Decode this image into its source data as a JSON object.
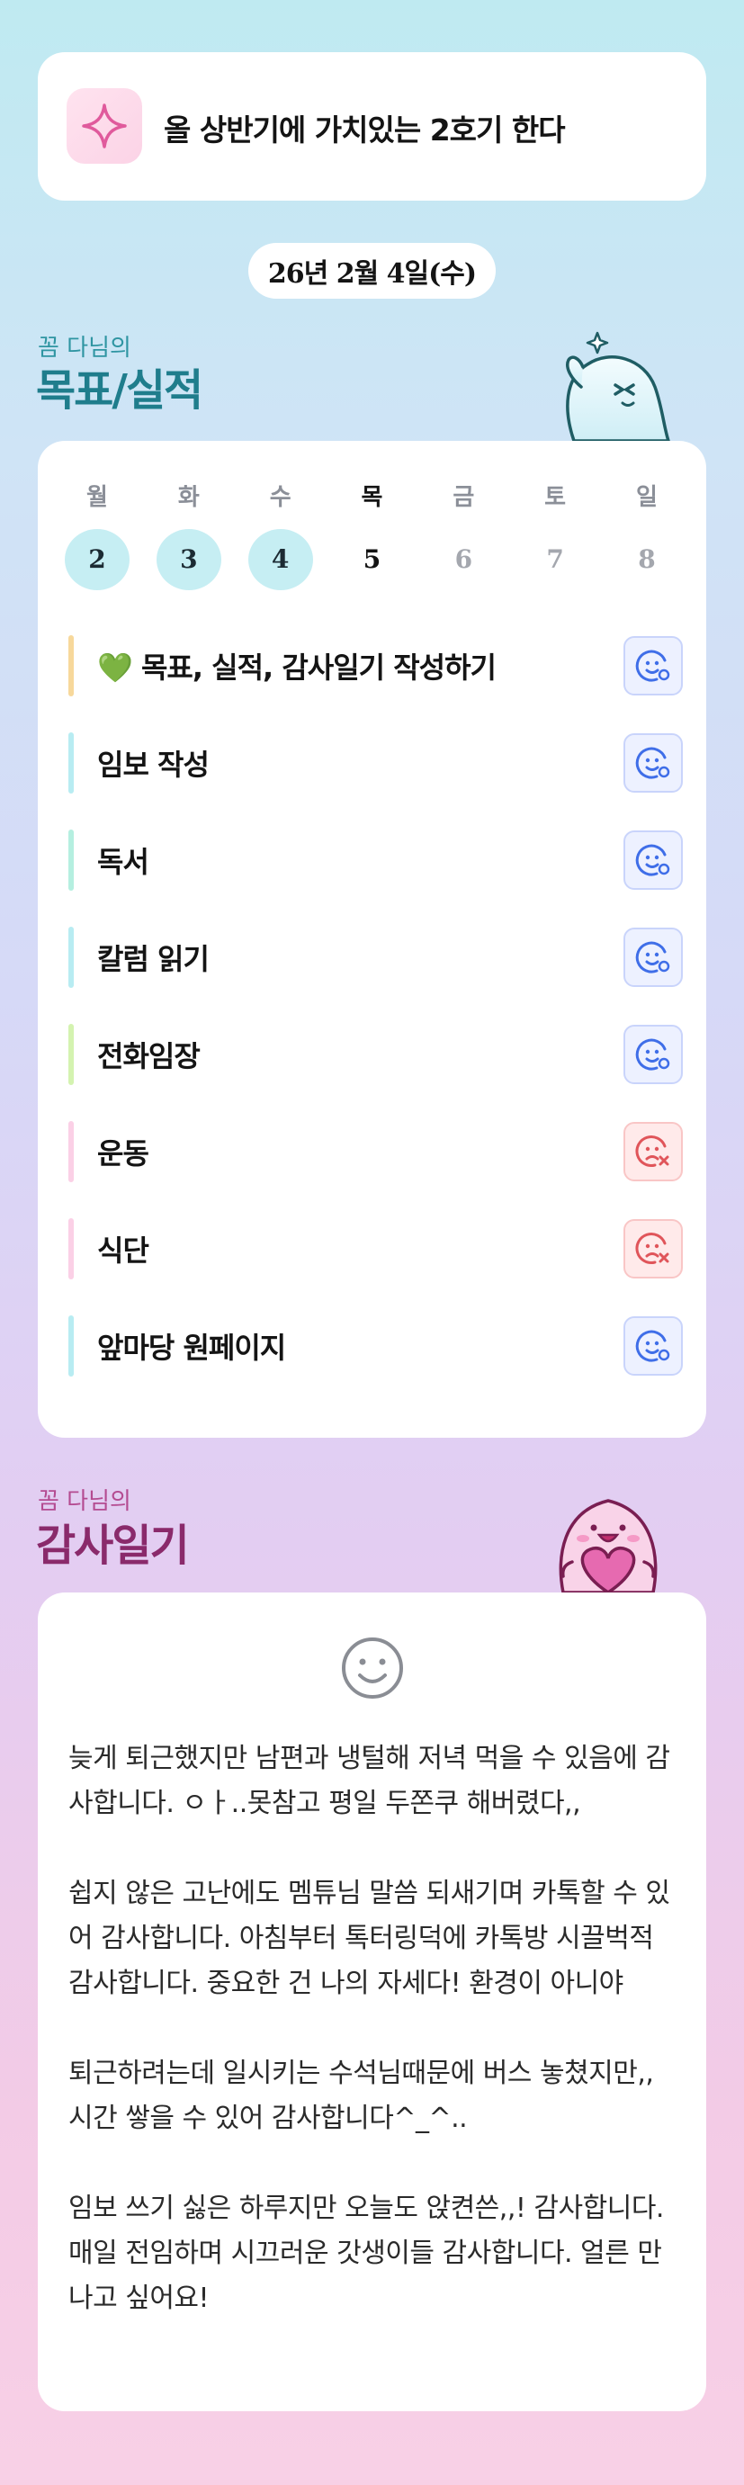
{
  "motto": {
    "text": "올 상반기에 가치있는 2호기 한다",
    "icon": "sparkle-icon"
  },
  "date_label": "26년 2월 4일(수)",
  "goals_section": {
    "small_title": "꼼 다님의",
    "big_title": "목표/실적"
  },
  "calendar": {
    "weekdays": [
      "월",
      "화",
      "수",
      "목",
      "금",
      "토",
      "일"
    ],
    "days": [
      "2",
      "3",
      "4",
      "5",
      "6",
      "7",
      "8"
    ],
    "completed_days": [
      "2",
      "3",
      "4"
    ],
    "today": "5"
  },
  "goals": [
    {
      "label": "💚 목표, 실적, 감사일기 작성하기",
      "status": "done",
      "bar_color": "#f7d89b"
    },
    {
      "label": "임보 작성",
      "status": "done",
      "bar_color": "#b8ecf2"
    },
    {
      "label": "독서",
      "status": "done",
      "bar_color": "#b5efe0"
    },
    {
      "label": "칼럼 읽기",
      "status": "done",
      "bar_color": "#b8ecf2"
    },
    {
      "label": "전화임장",
      "status": "done",
      "bar_color": "#d4f3b0"
    },
    {
      "label": "운동",
      "status": "missed",
      "bar_color": "#fbd0e6"
    },
    {
      "label": "식단",
      "status": "missed",
      "bar_color": "#fbd0e6"
    },
    {
      "label": "앞마당 원페이지",
      "status": "done",
      "bar_color": "#b8ecf2"
    }
  ],
  "gratitude_section": {
    "small_title": "꼼 다님의",
    "big_title": "감사일기"
  },
  "gratitude": {
    "mood_icon": "smile-icon",
    "entries": [
      "늦게 퇴근했지만 남편과 냉털해 저녁 먹을 수 있음에 감사합니다. ㅇㅏ..못참고 평일 두쫀쿠 해버렸다,,",
      "쉽지 않은 고난에도 멤튜님 말씀 되새기며 카톡할 수 있어 감사합니다. 아침부터 톡터링덕에 카톡방 시끌벅적 감사합니다. 중요한 건 나의 자세다! 환경이 아니야",
      "퇴근하려는데 일시키는 수석님때문에 버스 놓쳤지만,, 시간 쌓을 수 있어 감사합니다^_^..",
      "임보 쓰기 싫은 하루지만 오늘도 앉켠쓴,,! 감사합니다. 매일 전임하며 시끄러운 갓생이들 감사합니다. 얼른 만나고 싶어요!"
    ]
  }
}
